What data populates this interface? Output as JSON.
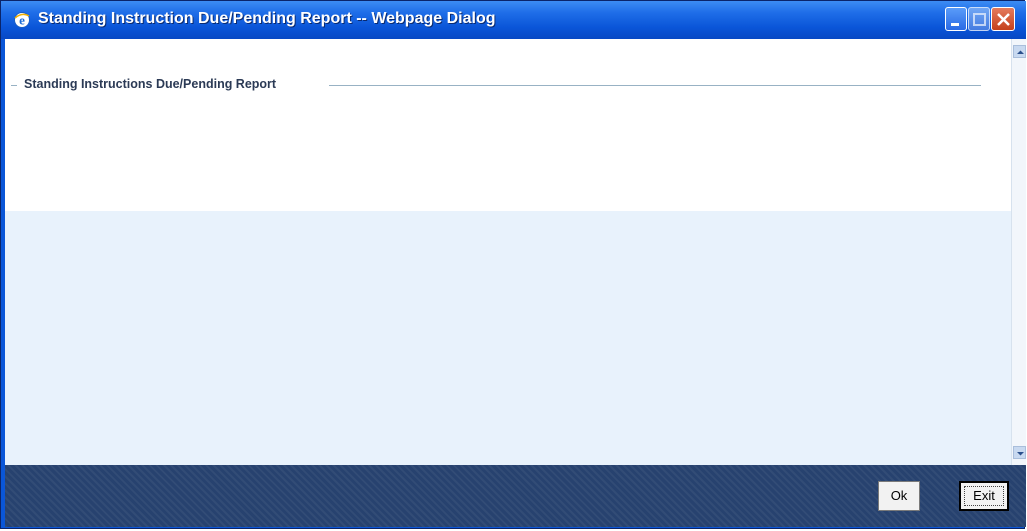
{
  "window": {
    "title": "Standing Instruction Due/Pending Report -- Webpage Dialog",
    "controls": [
      "minimize-icon",
      "maximize-icon",
      "close-icon"
    ]
  },
  "form": {
    "legend": "Standing Instructions Due/Pending Report"
  },
  "footer": {
    "ok_label": "Ok",
    "exit_label": "Exit"
  },
  "colors": {
    "titlebar": "#0a55d8",
    "footer": "#27426f",
    "content_bg": "#e8f2fc",
    "legend_text": "#2b3a55"
  }
}
